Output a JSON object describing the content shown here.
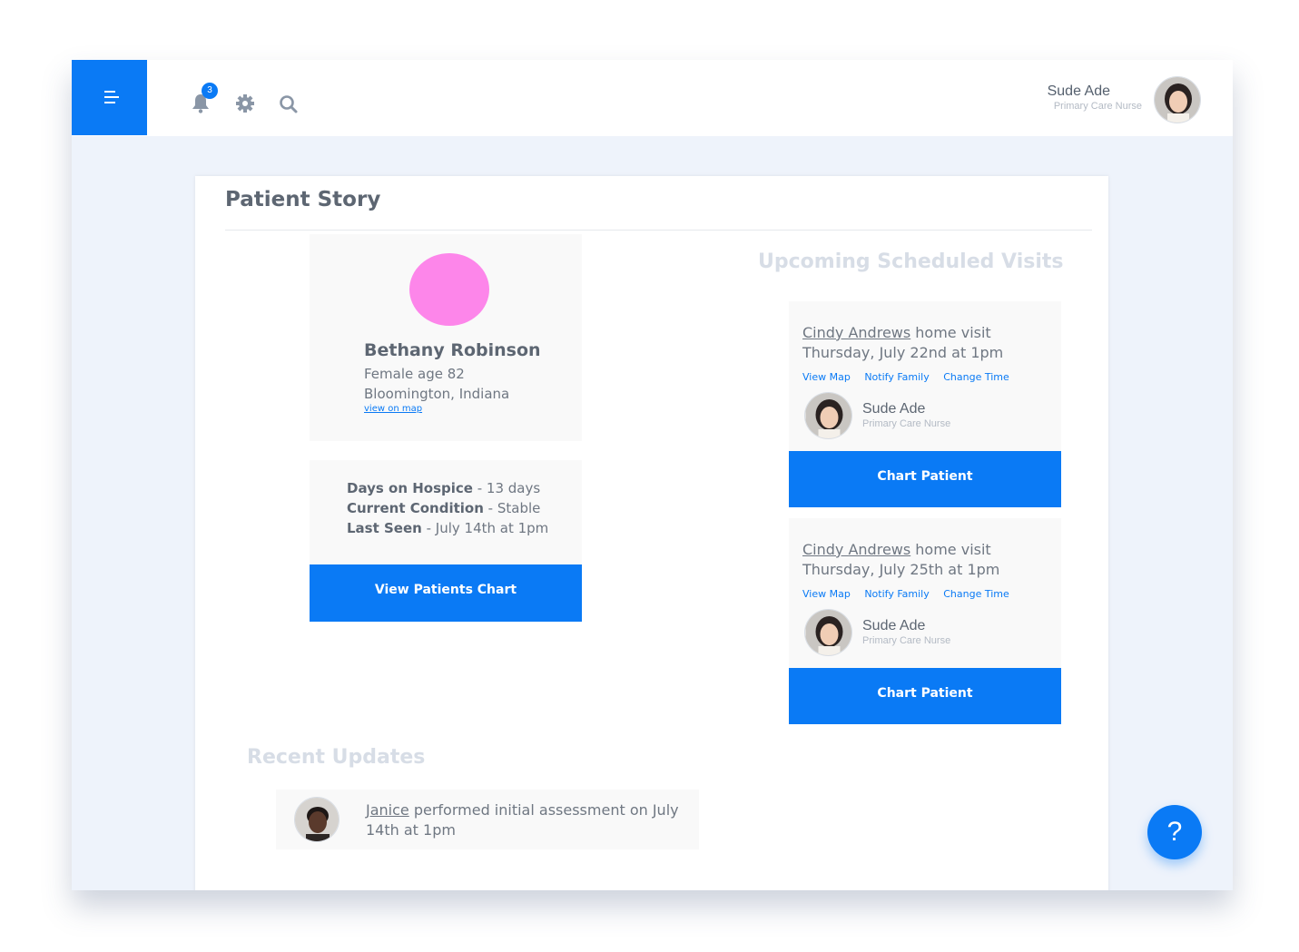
{
  "header": {
    "notification_count": "3",
    "user_name": "Sude Ade",
    "user_role": "Primary Care Nurse"
  },
  "card": {
    "title": "Patient Story"
  },
  "patient": {
    "name": "Bethany Robinson",
    "demographics": "Female age 82",
    "location": "Bloomington, Indiana",
    "map_link": "view on map",
    "avatar_color": "#fd86ea"
  },
  "stats": [
    {
      "label": "Days on Hospice",
      "value": " - 13 days"
    },
    {
      "label": "Current Condition",
      "value": " - Stable"
    },
    {
      "label": "Last Seen",
      "value": " - July 14th at 1pm"
    }
  ],
  "view_chart_button": "View Patients Chart",
  "upcoming": {
    "title": "Upcoming Scheduled Visits",
    "visits": [
      {
        "patient": "Cindy Andrews",
        "text": " home visit Thursday, July 22nd at 1pm",
        "links": [
          "View Map",
          "Notify Family",
          "Change Time"
        ],
        "nurse_name": "Sude Ade",
        "nurse_role": "Primary Care Nurse",
        "button": "Chart Patient"
      },
      {
        "patient": "Cindy Andrews",
        "text": " home visit Thursday, July 25th at 1pm",
        "links": [
          "View Map",
          "Notify Family",
          "Change Time"
        ],
        "nurse_name": "Sude Ade",
        "nurse_role": "Primary Care Nurse",
        "button": "Chart Patient"
      }
    ]
  },
  "recent": {
    "title": "Recent Updates",
    "items": [
      {
        "who": "Janice",
        "text": " performed initial assessment on  July 14th at 1pm"
      }
    ]
  },
  "help_label": "?",
  "colors": {
    "accent": "#0a7af5",
    "background": "#eef3fb"
  }
}
